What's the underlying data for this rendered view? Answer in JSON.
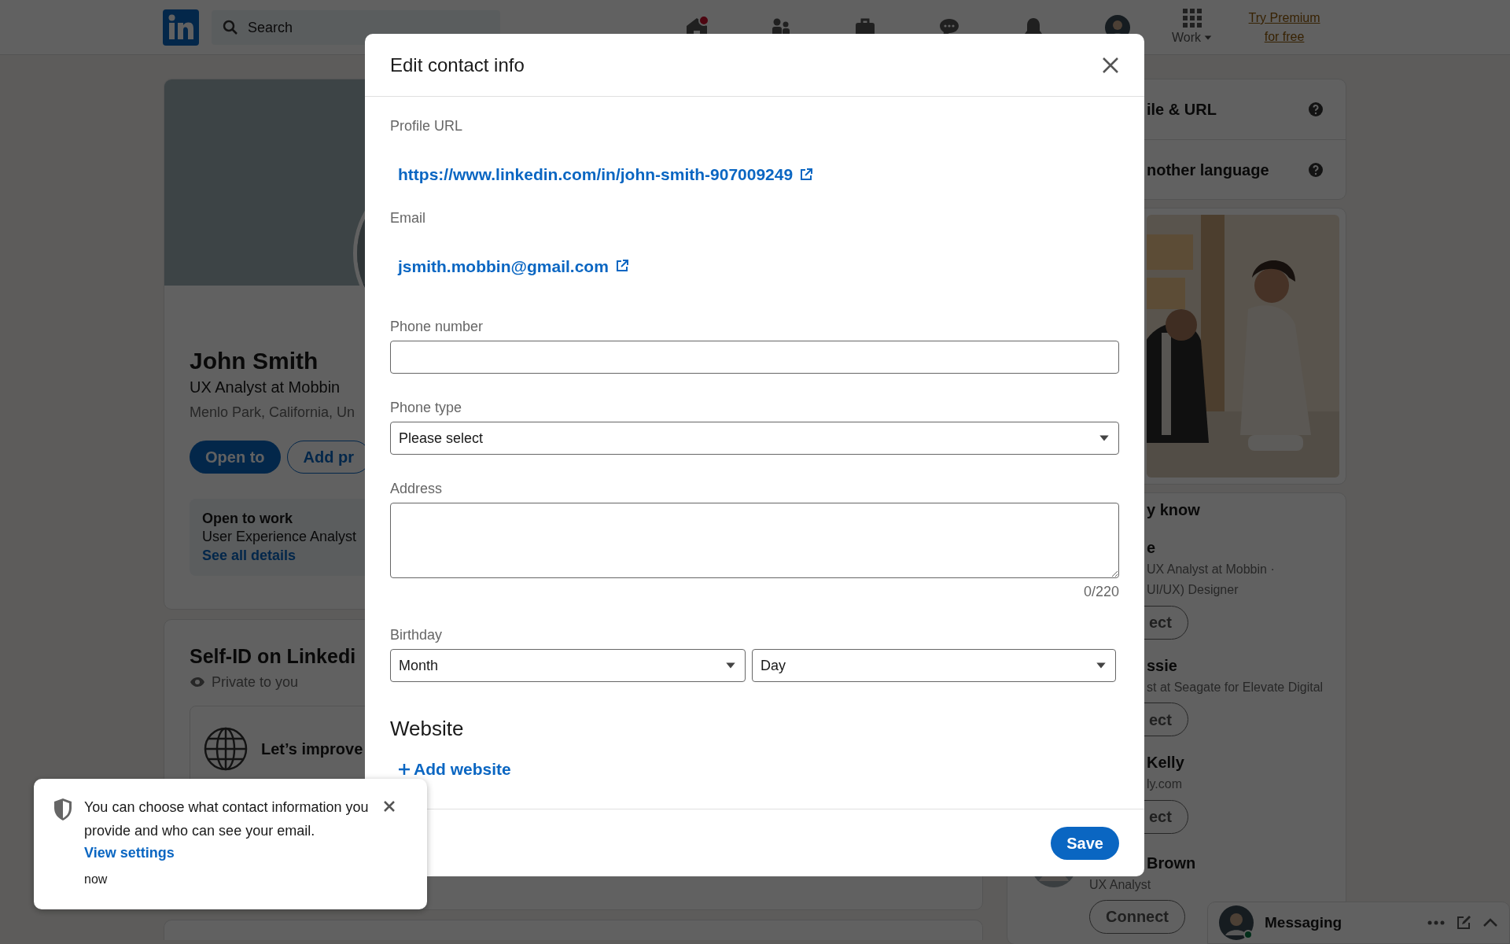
{
  "nav": {
    "search": {
      "placeholder": "Search"
    },
    "work_label": "Work",
    "premium": "Try Premium for free",
    "home_alert": true
  },
  "profile": {
    "name": "John Smith",
    "headline": "UX Analyst at Mobbin",
    "location": "Menlo Park, California, Un",
    "buttons": [
      {
        "label": "Open to",
        "kind": "primary"
      },
      {
        "label": "Add pr",
        "kind": "outline"
      }
    ],
    "open_to_work": {
      "title": "Open to work",
      "text": "User Experience Analyst",
      "link": "See all details"
    }
  },
  "self_id": {
    "title": "Self-ID on Linkedi",
    "privacy": "Private to you",
    "item": "Let’s improve"
  },
  "settings": [
    "ile & URL",
    "nother language"
  ],
  "people": {
    "title": "y know",
    "items": [
      {
        "name": "e",
        "lines": [
          "UX Analyst at Mobbin ·",
          "UI/UX) Designer"
        ],
        "button": "ect"
      },
      {
        "name": "ssie",
        "lines": [
          "st at Seagate for Elevate Digital"
        ],
        "button": "ect"
      },
      {
        "name": "Kelly",
        "lines": [
          "ly.com"
        ],
        "button": "ect"
      },
      {
        "name": "Brown",
        "lines": [
          "UX Analyst"
        ],
        "button": "Connect"
      }
    ]
  },
  "messaging": {
    "label": "Messaging"
  },
  "modal": {
    "title": "Edit contact info",
    "sections": [
      {
        "kind": "link",
        "label": "Profile URL",
        "value": "https://www.linkedin.com/in/john-smith-907009249"
      },
      {
        "kind": "link",
        "label": "Email",
        "value": "jsmith.mobbin@gmail.com"
      },
      {
        "kind": "input",
        "label": "Phone number"
      },
      {
        "kind": "select",
        "label": "Phone type",
        "value": "Please select"
      },
      {
        "kind": "textarea",
        "label": "Address",
        "counter": "0/220"
      },
      {
        "kind": "selects",
        "label": "Birthday",
        "values": [
          "Month",
          "Day"
        ]
      }
    ],
    "website_title": "Website",
    "add_website": "Add website",
    "save": "Save"
  },
  "toast": {
    "text": "You can choose what contact information you provide and who can see your email.",
    "link": "View settings",
    "time": "now"
  }
}
